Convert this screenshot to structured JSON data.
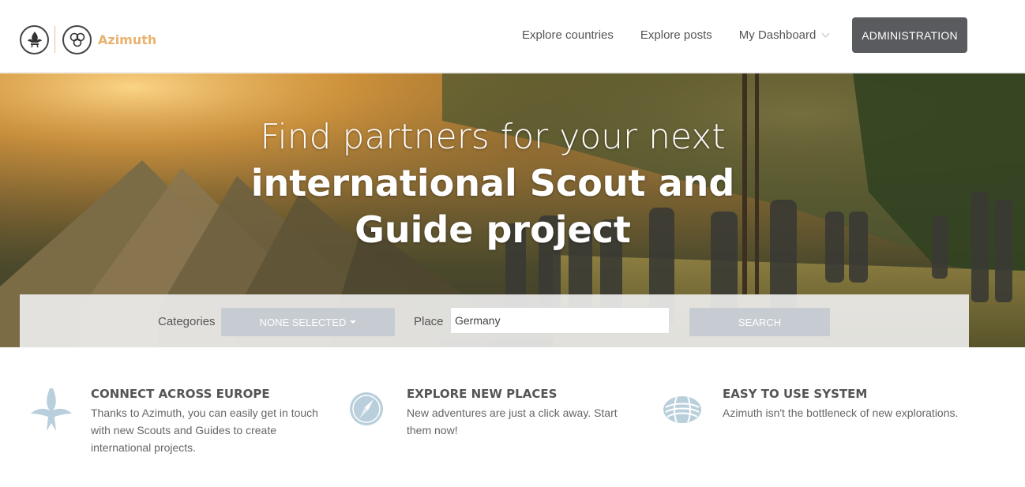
{
  "brand": {
    "name": "Azimuth"
  },
  "nav": {
    "links": [
      "Explore countries",
      "Explore posts",
      "My Dashboard"
    ],
    "admin_label": "ADMINISTRATION"
  },
  "hero": {
    "line1": "Find partners for your next",
    "line2": "international Scout and",
    "line3": "Guide project"
  },
  "search": {
    "categories_label": "Categories",
    "categories_value": "NONE SELECTED",
    "place_label": "Place",
    "place_value": "Germany",
    "search_label": "SEARCH"
  },
  "features": [
    {
      "title": "CONNECT ACROSS EUROPE",
      "text": "Thanks to Azimuth, you can easily get in touch with new Scouts and Guides to create international projects.",
      "icon": "fleur-icon"
    },
    {
      "title": "EXPLORE NEW PLACES",
      "text": "New adventures are just a click away. Start them now!",
      "icon": "compass-icon"
    },
    {
      "title": "EASY TO USE SYSTEM",
      "text": "Azimuth isn't the bottleneck of new explorations.",
      "icon": "knot-icon"
    }
  ],
  "colors": {
    "brand_accent": "#e9b36f",
    "admin_button": "#5a5b5e",
    "feature_icon": "#b9cfdc",
    "muted_button": "#c7ccd3"
  }
}
